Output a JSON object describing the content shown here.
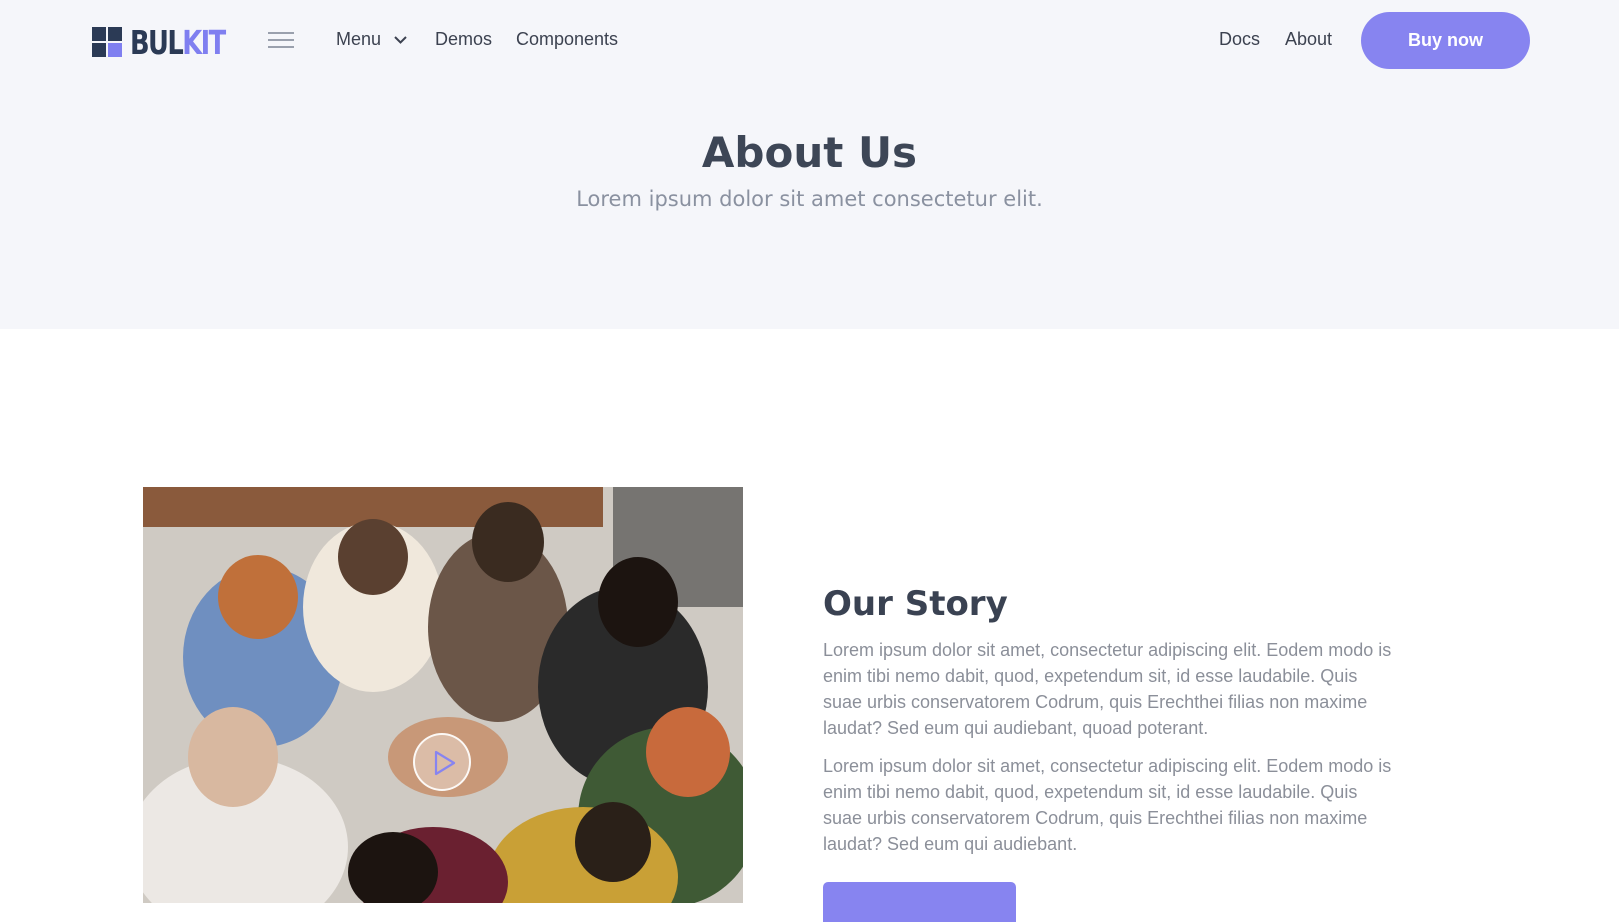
{
  "brand": {
    "name_part1": "BUL",
    "name_part2": "KIT",
    "accent_color": "#8784f0",
    "dark_color": "#2b3a55"
  },
  "nav": {
    "menu_icon": "hamburger-icon",
    "menu_label": "Menu",
    "menu_chevron_icon": "chevron-down-icon",
    "demos_label": "Demos",
    "components_label": "Components",
    "docs_label": "Docs",
    "about_label": "About",
    "buy_label": "Buy now"
  },
  "hero": {
    "title": "About Us",
    "subtitle": "Lorem ipsum dolor sit amet consectetur elit."
  },
  "story": {
    "image_alt": "team-huddle-photo",
    "play_icon": "play-icon",
    "title": "Our Story",
    "paragraphs": [
      "Lorem ipsum dolor sit amet, consectetur adipiscing elit. Eodem modo is enim tibi nemo dabit, quod, expetendum sit, id esse laudabile. Quis suae urbis conservatorem Codrum, quis Erechthei filias non maxime laudat? Sed eum qui audiebant, quoad poterant.",
      "Lorem ipsum dolor sit amet, consectetur adipiscing elit. Eodem modo is enim tibi nemo dabit, quod, expetendum sit, id esse laudabile. Quis suae urbis conservatorem Codrum, quis Erechthei filias non maxime laudat? Sed eum qui audiebant."
    ]
  }
}
